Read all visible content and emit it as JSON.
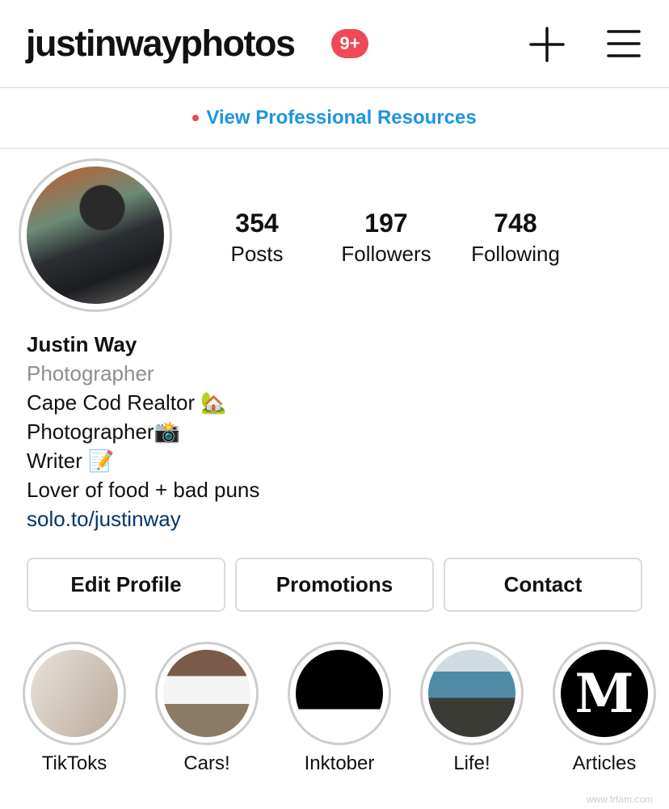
{
  "header": {
    "username": "justinwayphotos",
    "notification_badge": "9+",
    "icons": [
      "plus-icon",
      "menu-icon"
    ]
  },
  "pro_banner": {
    "label": "View Professional Resources",
    "dot_color": "#ed4956",
    "link_color": "#1b95e0"
  },
  "stats": [
    {
      "value": "354",
      "label": "Posts"
    },
    {
      "value": "197",
      "label": "Followers"
    },
    {
      "value": "748",
      "label": "Following"
    }
  ],
  "bio": {
    "name": "Justin Way",
    "category": "Photographer",
    "lines": [
      "Cape Cod Realtor 🏡",
      "Photographer📸",
      "Writer 📝",
      "Lover of food + bad puns"
    ],
    "link": "solo.to/justinway"
  },
  "buttons": [
    "Edit Profile",
    "Promotions",
    "Contact"
  ],
  "highlights": [
    {
      "label": "TikToks"
    },
    {
      "label": "Cars!"
    },
    {
      "label": "Inktober"
    },
    {
      "label": "Life!"
    },
    {
      "label": "Articles",
      "logo": "M"
    }
  ],
  "watermark": "www.frfam.com"
}
